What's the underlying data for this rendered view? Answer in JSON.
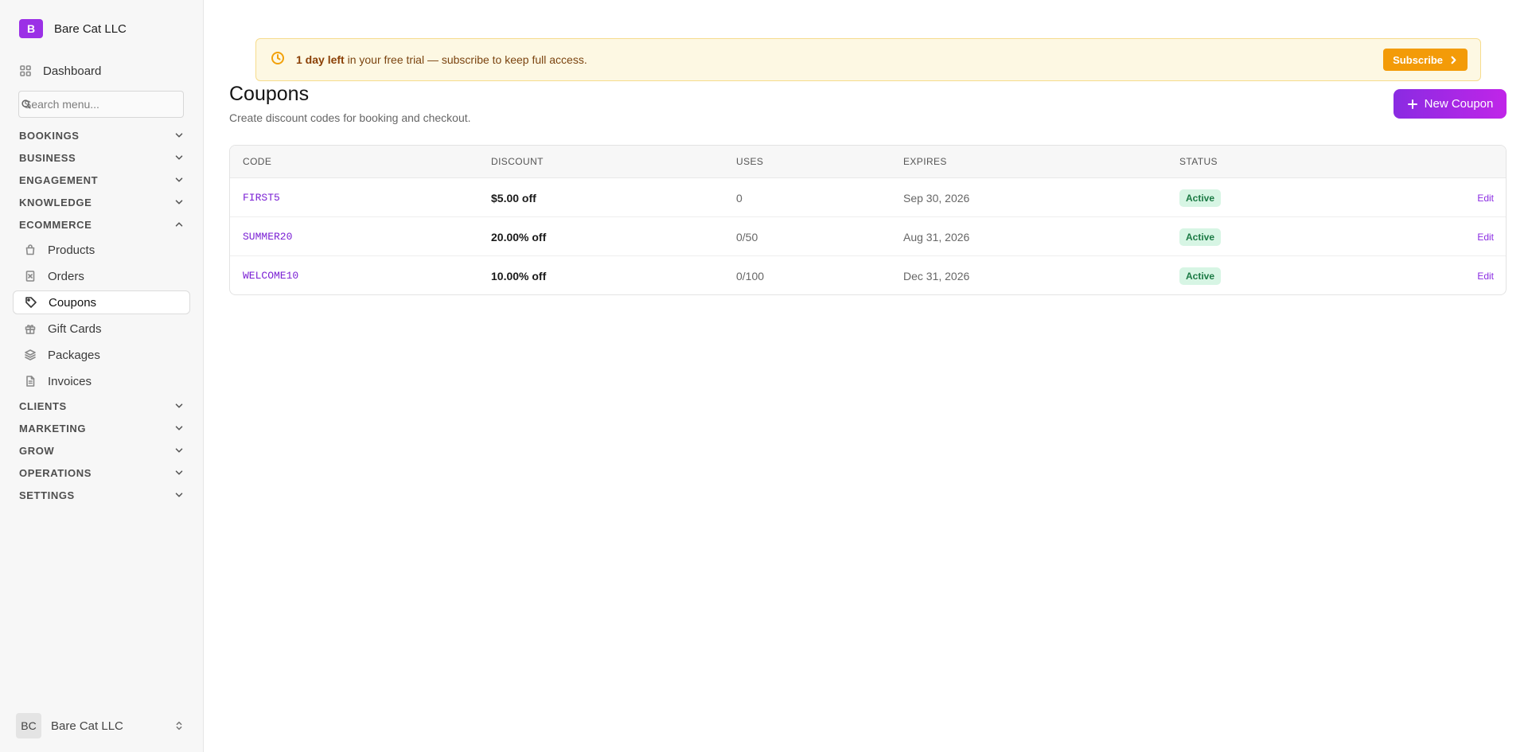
{
  "sidebar": {
    "brand": {
      "initial": "B",
      "name": "Bare Cat LLC"
    },
    "dashboard_label": "Dashboard",
    "search_placeholder": "Search menu...",
    "sections_top": [
      {
        "label": "BOOKINGS"
      },
      {
        "label": "BUSINESS"
      },
      {
        "label": "ENGAGEMENT"
      },
      {
        "label": "KNOWLEDGE"
      }
    ],
    "ecommerce": {
      "label": "ECOMMERCE",
      "items": [
        {
          "label": "Products",
          "icon": "bag-icon"
        },
        {
          "label": "Orders",
          "icon": "receipt-icon"
        },
        {
          "label": "Coupons",
          "icon": "tag-icon",
          "active": true
        },
        {
          "label": "Gift Cards",
          "icon": "gift-icon"
        },
        {
          "label": "Packages",
          "icon": "layers-icon"
        },
        {
          "label": "Invoices",
          "icon": "invoice-icon"
        }
      ]
    },
    "sections_bottom": [
      {
        "label": "CLIENTS"
      },
      {
        "label": "MARKETING"
      },
      {
        "label": "GROW"
      },
      {
        "label": "OPERATIONS"
      },
      {
        "label": "SETTINGS"
      }
    ],
    "account": {
      "initials": "BC",
      "name": "Bare Cat LLC"
    }
  },
  "banner": {
    "bold": "1 day left",
    "text": " in your free trial — subscribe to keep full access.",
    "button": "Subscribe",
    "accent": "#f39b08"
  },
  "page": {
    "title": "Coupons",
    "subtitle": "Create discount codes for booking and checkout.",
    "new_button": "New Coupon"
  },
  "table": {
    "columns": [
      "CODE",
      "DISCOUNT",
      "USES",
      "EXPIRES",
      "STATUS"
    ],
    "rows": [
      {
        "code": "FIRST5",
        "discount": "$5.00 off",
        "uses": "0",
        "expires": "Sep 30, 2026",
        "status": "Active",
        "action": "Edit"
      },
      {
        "code": "SUMMER20",
        "discount": "20.00% off",
        "uses": "0/50",
        "expires": "Aug 31, 2026",
        "status": "Active",
        "action": "Edit"
      },
      {
        "code": "WELCOME10",
        "discount": "10.00% off",
        "uses": "0/100",
        "expires": "Dec 31, 2026",
        "status": "Active",
        "action": "Edit"
      }
    ]
  },
  "colors": {
    "brand": "#9b30e6",
    "accent_purple": "#8a2be2",
    "status_active_bg": "#d7f5e4",
    "status_active_fg": "#1b7a44"
  }
}
